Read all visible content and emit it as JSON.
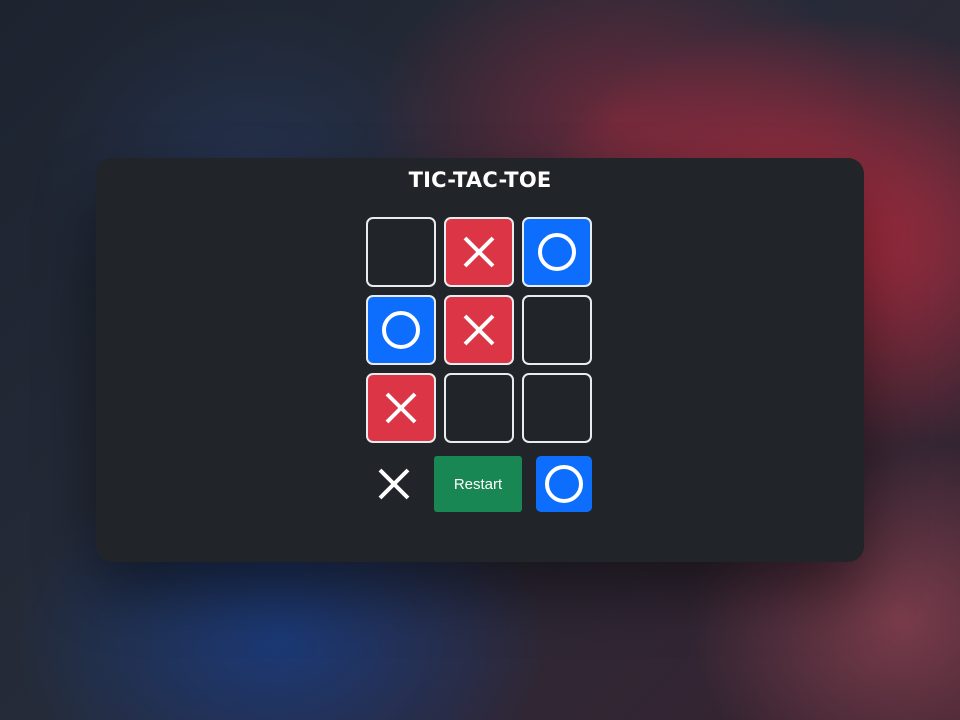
{
  "game": {
    "title": "TIC-TAC-TOE",
    "board": [
      [
        "",
        "X",
        "O"
      ],
      [
        "O",
        "X",
        ""
      ],
      [
        "X",
        "",
        ""
      ]
    ]
  },
  "controls": {
    "restart_label": "Restart",
    "player_x_indicator": "X",
    "player_o_indicator": "O"
  },
  "colors": {
    "x_cell": "#dc3545",
    "o_cell": "#0d6efd",
    "empty_cell": "#212428",
    "restart_button": "#198754",
    "card": "#212428"
  }
}
